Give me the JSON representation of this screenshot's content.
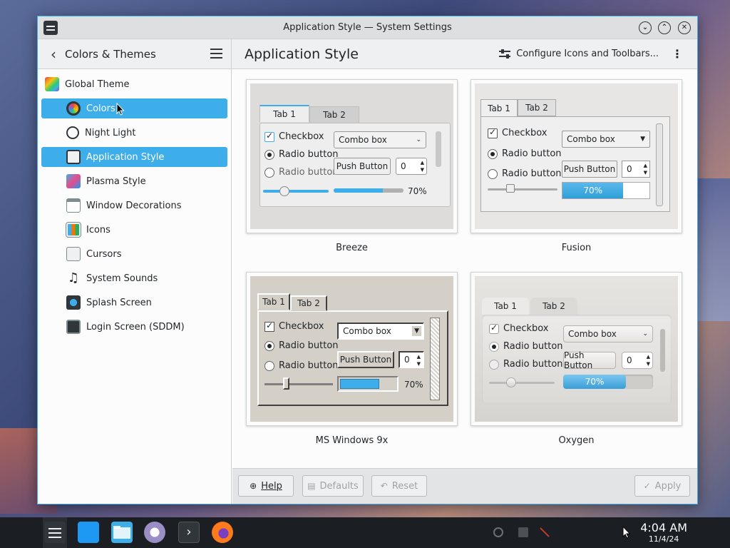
{
  "window": {
    "title": "Application Style — System Settings",
    "buttons": {
      "minimize": "⌄",
      "maximize": "⌃",
      "close": "✕"
    }
  },
  "header": {
    "breadcrumb": "Colors & Themes",
    "page_title": "Application Style",
    "configure_label": "Configure Icons and Toolbars...",
    "kebab": "⋮",
    "back": "‹"
  },
  "sidebar": {
    "items": [
      {
        "label": "Global Theme",
        "icon": "global-theme-icon",
        "selected": false
      },
      {
        "label": "Colors",
        "icon": "colors-icon",
        "selected": true
      },
      {
        "label": "Night Light",
        "icon": "night-light-icon",
        "selected": false
      },
      {
        "label": "Application Style",
        "icon": "application-style-icon",
        "selected": true
      },
      {
        "label": "Plasma Style",
        "icon": "plasma-style-icon",
        "selected": false
      },
      {
        "label": "Window Decorations",
        "icon": "window-decorations-icon",
        "selected": false
      },
      {
        "label": "Icons",
        "icon": "icons-icon",
        "selected": false
      },
      {
        "label": "Cursors",
        "icon": "cursors-icon",
        "selected": false
      },
      {
        "label": "System Sounds",
        "icon": "system-sounds-icon",
        "selected": false
      },
      {
        "label": "Splash Screen",
        "icon": "splash-screen-icon",
        "selected": false
      },
      {
        "label": "Login Screen (SDDM)",
        "icon": "login-screen-icon",
        "selected": false
      }
    ]
  },
  "styles": [
    {
      "name": "Breeze"
    },
    {
      "name": "Fusion"
    },
    {
      "name": "MS Windows 9x"
    },
    {
      "name": "Oxygen"
    }
  ],
  "preview": {
    "tab1": "Tab 1",
    "tab2": "Tab 2",
    "checkbox": "Checkbox",
    "radio": "Radio button",
    "combo": "Combo box",
    "push": "Push Button",
    "spin_value": "0",
    "progress_text": "70%",
    "progress_value": 0.7
  },
  "footer": {
    "help": "Help",
    "defaults": "Defaults",
    "reset": "Reset",
    "apply": "Apply"
  },
  "taskbar": {
    "time": "4:04 AM",
    "date": "11/4/24"
  },
  "colors": {
    "accent": "#3daee9",
    "selection_text": "#ffffff",
    "taskbar": "#1b1e22"
  }
}
